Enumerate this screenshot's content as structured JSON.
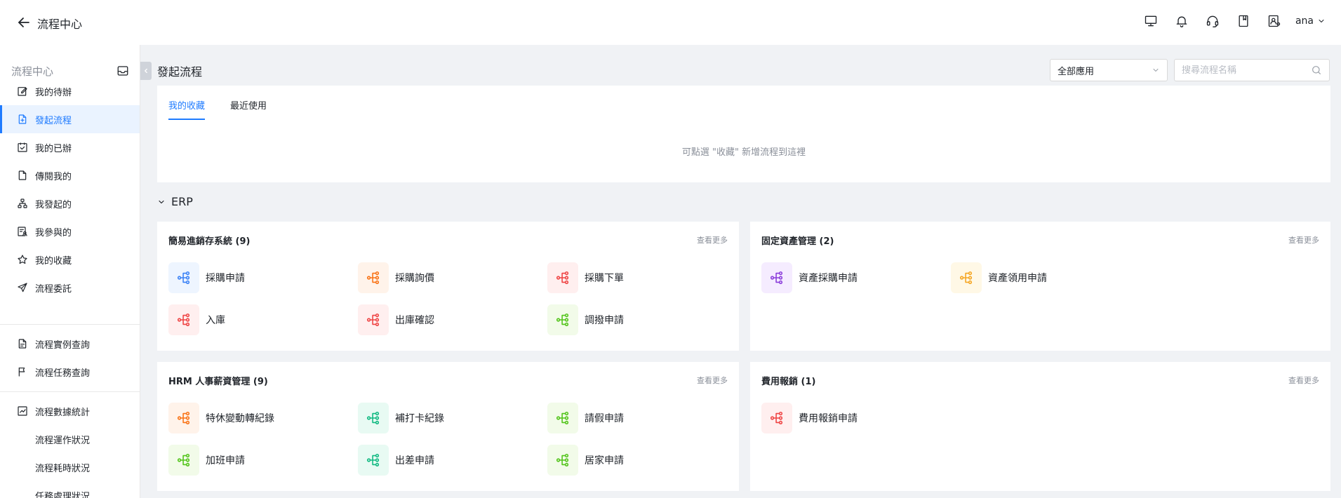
{
  "topbar": {
    "title": "流程中心",
    "username": "ana"
  },
  "sidebar": {
    "heading": "流程中心",
    "items": [
      {
        "label": "我的待辦",
        "icon": "edit-icon"
      },
      {
        "label": "發起流程",
        "icon": "file-add-icon"
      },
      {
        "label": "我的已辦",
        "icon": "check-square-icon"
      },
      {
        "label": "傳閱我的",
        "icon": "file-icon"
      },
      {
        "label": "我發起的",
        "icon": "flow-icon"
      },
      {
        "label": "我參與的",
        "icon": "file-user-icon"
      },
      {
        "label": "我的收藏",
        "icon": "star-icon"
      },
      {
        "label": "流程委託",
        "icon": "send-icon"
      },
      {
        "label": "流程實例查詢",
        "icon": "file-search-icon"
      },
      {
        "label": "流程任務查詢",
        "icon": "flag-icon"
      },
      {
        "label": "流程數據統計",
        "icon": "chart-icon"
      },
      {
        "label": "流程運作狀況",
        "icon": ""
      },
      {
        "label": "流程耗時狀況",
        "icon": ""
      },
      {
        "label": "任務處理狀況",
        "icon": ""
      }
    ]
  },
  "main": {
    "title": "發起流程",
    "app_select": "全部應用",
    "search_placeholder": "搜尋流程名稱",
    "tabs": [
      {
        "label": "我的收藏"
      },
      {
        "label": "最近使用"
      }
    ],
    "empty_text": "可點選 \"收藏\" 新增流程到這裡",
    "group_name": "ERP",
    "more_label": "查看更多",
    "categories": [
      {
        "title": "簡易進銷存系統 (9)",
        "items": [
          {
            "label": "採購申請",
            "color": "#3b82f6",
            "bg": "#eef5ff"
          },
          {
            "label": "採購詢價",
            "color": "#f97316",
            "bg": "#fff3ea"
          },
          {
            "label": "採購下單",
            "color": "#ef4444",
            "bg": "#ffefef"
          },
          {
            "label": "入庫",
            "color": "#ef4444",
            "bg": "#ffefef"
          },
          {
            "label": "出庫確認",
            "color": "#ef4444",
            "bg": "#ffefef"
          },
          {
            "label": "調撥申請",
            "color": "#52c41a",
            "bg": "#f2fbe9"
          }
        ]
      },
      {
        "title": "固定資產管理 (2)",
        "items": [
          {
            "label": "資產採購申請",
            "color": "#8b3ddb",
            "bg": "#f5ecff"
          },
          {
            "label": "資產領用申請",
            "color": "#f5a623",
            "bg": "#fff8e6"
          }
        ]
      },
      {
        "title": "HRM 人事薪資管理 (9)",
        "items": [
          {
            "label": "特休變動轉紀錄",
            "color": "#f97316",
            "bg": "#fff3ea"
          },
          {
            "label": "補打卡紀錄",
            "color": "#10b981",
            "bg": "#e8faf3"
          },
          {
            "label": "請假申請",
            "color": "#52c41a",
            "bg": "#f2fbe9"
          },
          {
            "label": "加班申請",
            "color": "#52c41a",
            "bg": "#f2fbe9"
          },
          {
            "label": "出差申請",
            "color": "#10b981",
            "bg": "#e8faf3"
          },
          {
            "label": "居家申請",
            "color": "#52c41a",
            "bg": "#f2fbe9"
          }
        ]
      },
      {
        "title": "費用報銷 (1)",
        "items": [
          {
            "label": "費用報銷申請",
            "color": "#ef4444",
            "bg": "#ffefef"
          }
        ]
      }
    ]
  }
}
